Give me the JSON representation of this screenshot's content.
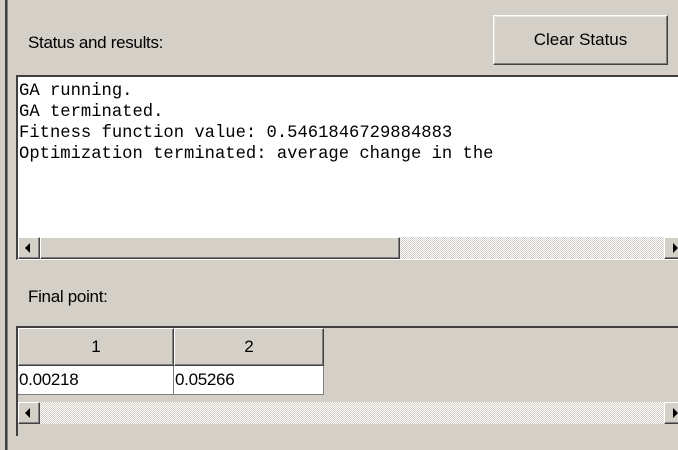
{
  "status_section": {
    "label": "Status and results:",
    "clear_button_label": "Clear Status",
    "lines": [
      "GA running.",
      "GA terminated.",
      "Fitness function value: 0.5461846729884883",
      "Optimization terminated: average change in the"
    ]
  },
  "final_point": {
    "label": "Final point:",
    "columns": [
      "1",
      "2"
    ],
    "values": [
      "0.00218",
      "0.05266"
    ]
  },
  "icons": {
    "scroll_left": "scroll-left-arrow-icon",
    "scroll_right": "scroll-right-arrow-icon"
  }
}
